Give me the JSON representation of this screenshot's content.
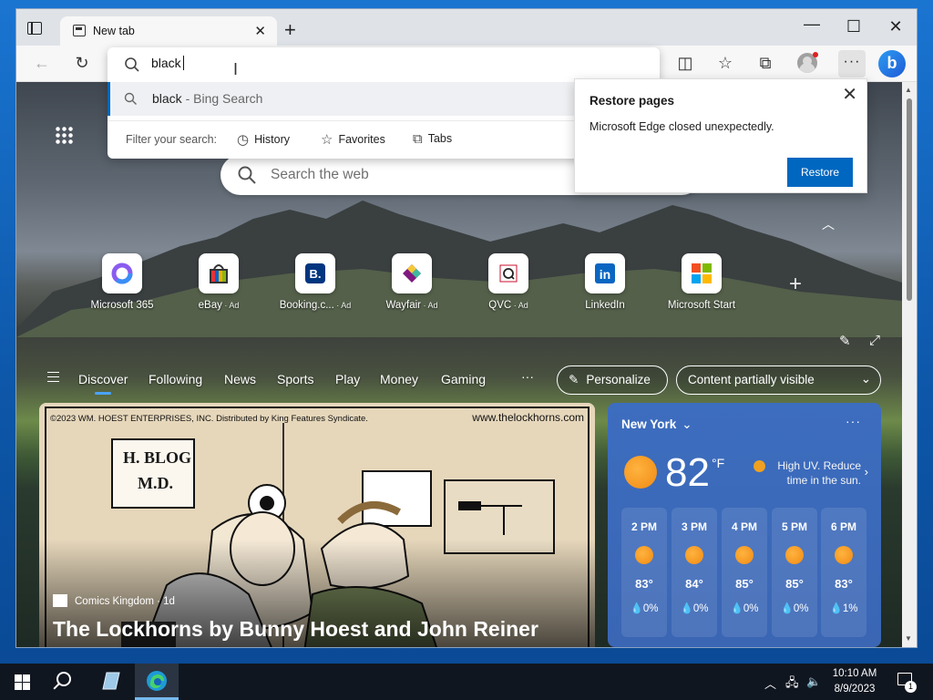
{
  "browser": {
    "tab_title": "New tab",
    "address_text": "black",
    "suggestion": {
      "query": "black",
      "source": " - Bing Search"
    },
    "filter_label": "Filter your search:",
    "filters": [
      "History",
      "Favorites",
      "Tabs"
    ]
  },
  "restore_popup": {
    "title": "Restore pages",
    "message": "Microsoft Edge closed unexpectedly.",
    "button": "Restore"
  },
  "ntp": {
    "search_placeholder": "Search the web",
    "tiles": [
      {
        "label": "Microsoft 365",
        "ad": ""
      },
      {
        "label": "eBay",
        "ad": " · Ad"
      },
      {
        "label": "Booking.c...",
        "ad": " · Ad"
      },
      {
        "label": "Wayfair",
        "ad": " · Ad"
      },
      {
        "label": "QVC",
        "ad": " · Ad"
      },
      {
        "label": "LinkedIn",
        "ad": ""
      },
      {
        "label": "Microsoft Start",
        "ad": ""
      }
    ],
    "nav": [
      "Discover",
      "Following",
      "News",
      "Sports",
      "Play",
      "Money",
      "Gaming"
    ],
    "nav_more": "···",
    "personalize": "Personalize",
    "content_visibility": "Content partially visible"
  },
  "comic": {
    "copyright": "©2023 WM. HOEST ENTERPRISES, INC. Distributed by King Features Syndicate.",
    "url": "www.thelockhorns.com",
    "sign_line1": "H. BLOG",
    "sign_line2": "M.D.",
    "source": "Comics Kingdom · 1d",
    "title": "The Lockhorns by Bunny Hoest and John Reiner"
  },
  "weather": {
    "city": "New York",
    "temp": "82",
    "unit": "°F",
    "alert": "High UV. Reduce time in the sun.",
    "hours": [
      {
        "time": "2 PM",
        "temp": "83°",
        "precip": "💧0%"
      },
      {
        "time": "3 PM",
        "temp": "84°",
        "precip": "💧0%"
      },
      {
        "time": "4 PM",
        "temp": "85°",
        "precip": "💧0%"
      },
      {
        "time": "5 PM",
        "temp": "85°",
        "precip": "💧0%"
      },
      {
        "time": "6 PM",
        "temp": "83°",
        "precip": "💧1%"
      }
    ]
  },
  "taskbar": {
    "time": "10:10 AM",
    "date": "8/9/2023",
    "notifications": "1"
  },
  "colors": {
    "accent": "#0067c0",
    "weather_card": "#3d6dbf",
    "taskbar": "#101620"
  }
}
